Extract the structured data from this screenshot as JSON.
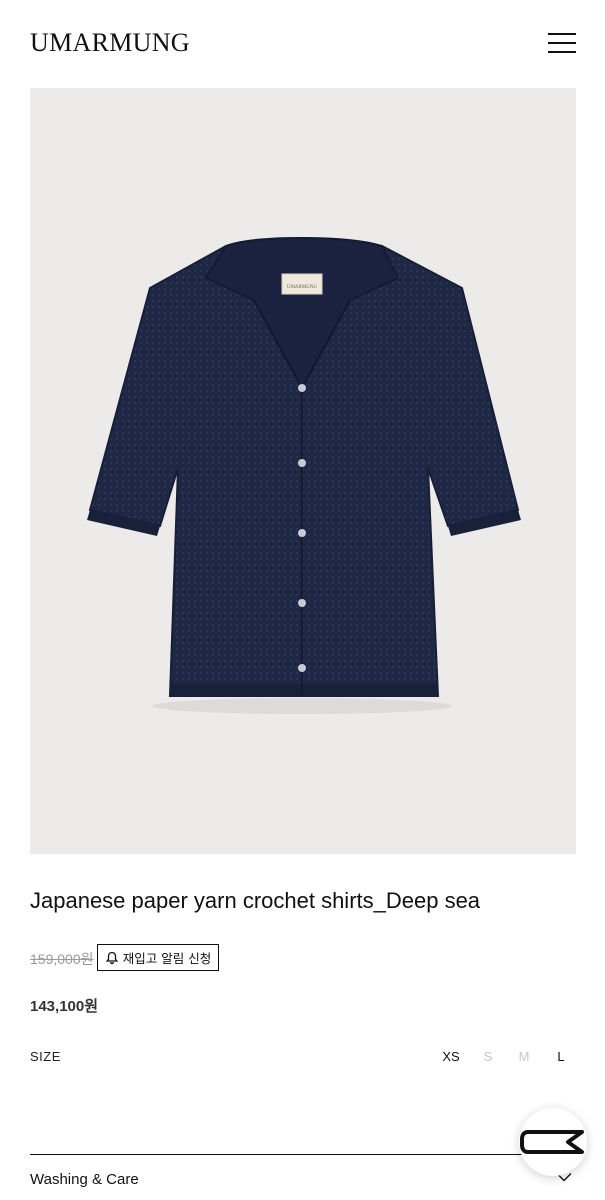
{
  "header": {
    "logo": "UMARMUNG"
  },
  "product": {
    "image_label": "UMARMUNG",
    "title": "Japanese paper yarn crochet shirts_Deep sea",
    "original_price": "159,000원",
    "restock_label": "재입고 알림 신청",
    "sale_price": "143,100원",
    "size_label": "SIZE",
    "sizes": [
      {
        "label": "XS",
        "status": "available"
      },
      {
        "label": "S",
        "status": "sold-out"
      },
      {
        "label": "M",
        "status": "sold-out"
      },
      {
        "label": "L",
        "status": "available"
      }
    ]
  },
  "accordion": {
    "washing_label": "Washing & Care"
  },
  "colors": {
    "garment": "#1e2744",
    "background": "#ecebea",
    "text": "#111111"
  },
  "icons": [
    "menu-icon",
    "bell-icon",
    "chevron-down-icon",
    "chat-icon"
  ]
}
